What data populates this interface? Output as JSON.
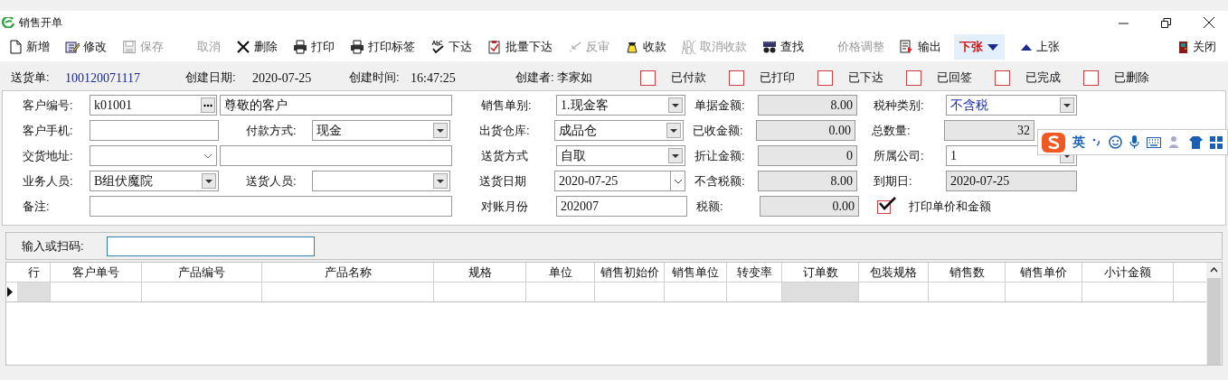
{
  "window": {
    "title": "销售开单"
  },
  "toolbar": [
    {
      "label": "新增",
      "disabled": false
    },
    {
      "label": "修改",
      "disabled": false
    },
    {
      "label": "保存",
      "disabled": true
    },
    {
      "label": "取消",
      "disabled": true
    },
    {
      "label": "删除",
      "disabled": false
    },
    {
      "label": "打印",
      "disabled": false
    },
    {
      "label": "打印标签",
      "disabled": false
    },
    {
      "label": "下达",
      "disabled": false
    },
    {
      "label": "批量下达",
      "disabled": false
    },
    {
      "label": "反审",
      "disabled": true
    },
    {
      "label": "收款",
      "disabled": false
    },
    {
      "label": "取消收款",
      "disabled": true
    },
    {
      "label": "查找",
      "disabled": false
    },
    {
      "label": "价格调整",
      "disabled": true
    },
    {
      "label": "输出",
      "disabled": false
    },
    {
      "label": "下张",
      "disabled": false,
      "selected": true
    },
    {
      "label": "上张",
      "disabled": false,
      "selected": false
    },
    {
      "label": "关闭",
      "disabled": false
    }
  ],
  "header": {
    "doc_label": "送货单:",
    "doc_no": "100120071117",
    "date_label": "创建日期:",
    "date": "2020-07-25",
    "time_label": "创建时间:",
    "time": "16:47:25",
    "creator": "创建者: 李家如"
  },
  "flags": [
    {
      "label": "已付款",
      "checked": false
    },
    {
      "label": "已打印",
      "checked": false
    },
    {
      "label": "已下达",
      "checked": false
    },
    {
      "label": "已回签",
      "checked": false
    },
    {
      "label": "已完成",
      "checked": false
    },
    {
      "label": "已删除",
      "checked": false
    }
  ],
  "form_rows": [
    {
      "left": [
        {
          "label": "客户编号:",
          "kind": "lookup",
          "value": "k01001"
        },
        {
          "kind": "text",
          "value": "尊敬的客户"
        }
      ],
      "mid": {
        "label": "销售单别:",
        "kind": "select",
        "value": "1.现金客"
      },
      "amount": {
        "label": "单据金额:",
        "value": "8.00"
      },
      "right": {
        "label": "税种类别:",
        "kind": "select",
        "value": "不含税",
        "accent": true
      }
    },
    {
      "left": [
        {
          "label": "客户手机:",
          "kind": "text"
        },
        {
          "label": "付款方式:",
          "kind": "select",
          "value": "现金"
        }
      ],
      "mid": {
        "label": "出货仓库:",
        "kind": "select",
        "value": "成品仓"
      },
      "amount": {
        "label": "已收金额:",
        "value": "0.00"
      },
      "right": {
        "label": "总数量:",
        "kind": "number",
        "value": "32"
      }
    },
    {
      "left": [
        {
          "label": "交货地址:",
          "kind": "combo"
        },
        {
          "kind": "text"
        }
      ],
      "mid": {
        "label": "送货方式",
        "kind": "select",
        "value": "自取"
      },
      "amount": {
        "label": "折让金额:",
        "value": "0"
      },
      "right": {
        "label": "所属公司:",
        "kind": "select",
        "value": "1"
      }
    },
    {
      "left": [
        {
          "label": "业务人员:",
          "kind": "select",
          "value": "B组伏魔院"
        },
        {
          "label": "送货人员:",
          "kind": "select"
        }
      ],
      "mid": {
        "label": "送货日期",
        "kind": "date",
        "value": "2020-07-25"
      },
      "amount": {
        "label": "不含税额:",
        "value": "8.00"
      },
      "right": {
        "label": "到期日:",
        "kind": "readonly",
        "value": "2020-07-25"
      }
    },
    {
      "left": [
        {
          "label": "备注:",
          "kind": "wide"
        }
      ],
      "mid": {
        "label": "对账月份",
        "kind": "text",
        "value": "202007"
      },
      "amount": {
        "label": "税额:",
        "value": "0.00"
      },
      "right": {
        "label": "打印单价和金额",
        "kind": "checkbox",
        "checked": true
      }
    }
  ],
  "scan": {
    "label": "输入或扫码:"
  },
  "table": {
    "columns": [
      {
        "label": "行",
        "shaded": true
      },
      {
        "label": "客户单号",
        "shaded": false
      },
      {
        "label": "产品编号",
        "shaded": false
      },
      {
        "label": "产品名称",
        "shaded": false
      },
      {
        "label": "规格",
        "shaded": false
      },
      {
        "label": "单位",
        "shaded": false
      },
      {
        "label": "销售初始价",
        "shaded": false
      },
      {
        "label": "销售单位",
        "shaded": false
      },
      {
        "label": "转变率",
        "shaded": false
      },
      {
        "label": "订单数",
        "shaded": true
      },
      {
        "label": "包装规格",
        "shaded": false
      },
      {
        "label": "销售数",
        "shaded": false
      },
      {
        "label": "销售单价",
        "shaded": false
      },
      {
        "label": "小计金额",
        "shaded": false
      }
    ],
    "rows": [
      {
        "current": true
      }
    ]
  },
  "ime_bar": {
    "mode": "英"
  }
}
